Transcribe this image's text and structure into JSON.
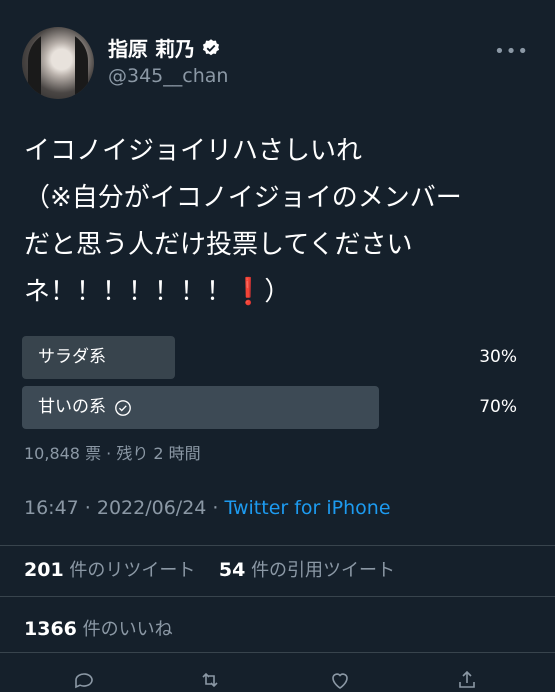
{
  "user": {
    "display_name": "指原 莉乃",
    "handle": "@345__chan",
    "verified": true,
    "more_label": "•••"
  },
  "tweet": {
    "text": "イコノイジョイリハさしいれ\n（※自分がイコノイジョイのメンバー\nだと思う人だけ投票してください\nネ！！！！！！！❗️）"
  },
  "poll": {
    "options": [
      {
        "label": "サラダ系",
        "percent_text": "30%",
        "percent": 30,
        "chosen": false
      },
      {
        "label": "甘いの系",
        "percent_text": "70%",
        "percent": 70,
        "chosen": true
      }
    ],
    "meta": "10,848 票 · 残り 2 時間"
  },
  "timestamp": {
    "time": "16:47 · 2022/06/24 · ",
    "source": "Twitter for iPhone"
  },
  "stats": {
    "retweets_count": "201",
    "retweets_label": "件のリツイート",
    "quotes_count": "54",
    "quotes_label": "件の引用ツイート",
    "likes_count": "1366",
    "likes_label": "件のいいね"
  },
  "colors": {
    "background": "#15202b",
    "accent": "#1d9bf0",
    "muted": "#8b98a5"
  }
}
